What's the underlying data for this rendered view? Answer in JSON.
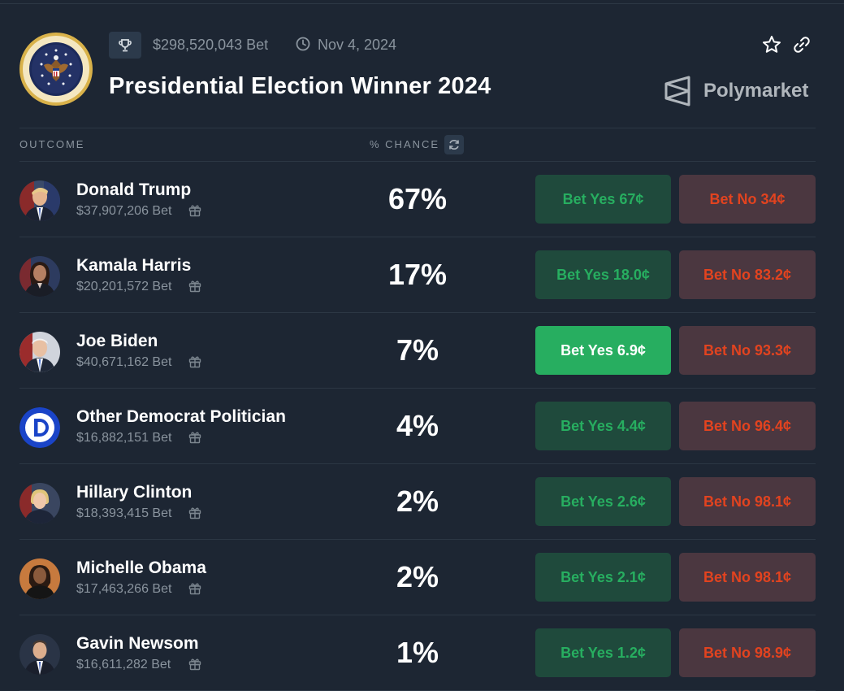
{
  "header": {
    "volume": "$298,520,043 Bet",
    "date": "Nov 4, 2024",
    "title": "Presidential Election Winner 2024",
    "brand": "Polymarket",
    "seal_text": "SEAL OF THE PRESIDENT OF THE UNITED STATES"
  },
  "columns": {
    "outcome": "OUTCOME",
    "chance": "% CHANCE"
  },
  "colors": {
    "background": "#1d2633",
    "yes": "#27ae60",
    "no": "#e2431f"
  },
  "outcomes": [
    {
      "name": "Donald Trump",
      "bet": "$37,907,206 Bet",
      "chance": "67%",
      "yes": "Bet Yes 67¢",
      "no": "Bet No 34¢",
      "avatar": "trump-portrait"
    },
    {
      "name": "Kamala Harris",
      "bet": "$20,201,572 Bet",
      "chance": "17%",
      "yes": "Bet Yes 18.0¢",
      "no": "Bet No 83.2¢",
      "avatar": "harris-portrait"
    },
    {
      "name": "Joe Biden",
      "bet": "$40,671,162 Bet",
      "chance": "7%",
      "yes": "Bet Yes 6.9¢",
      "no": "Bet No 93.3¢",
      "avatar": "biden-portrait",
      "yes_active": true
    },
    {
      "name": "Other Democrat Politician",
      "bet": "$16,882,151 Bet",
      "chance": "4%",
      "yes": "Bet Yes 4.4¢",
      "no": "Bet No 96.4¢",
      "avatar": "democrat-logo"
    },
    {
      "name": "Hillary Clinton",
      "bet": "$18,393,415 Bet",
      "chance": "2%",
      "yes": "Bet Yes 2.6¢",
      "no": "Bet No 98.1¢",
      "avatar": "clinton-portrait"
    },
    {
      "name": "Michelle Obama",
      "bet": "$17,463,266 Bet",
      "chance": "2%",
      "yes": "Bet Yes 2.1¢",
      "no": "Bet No 98.1¢",
      "avatar": "obama-portrait"
    },
    {
      "name": "Gavin Newsom",
      "bet": "$16,611,282 Bet",
      "chance": "1%",
      "yes": "Bet Yes 1.2¢",
      "no": "Bet No 98.9¢",
      "avatar": "newsom-portrait"
    }
  ]
}
